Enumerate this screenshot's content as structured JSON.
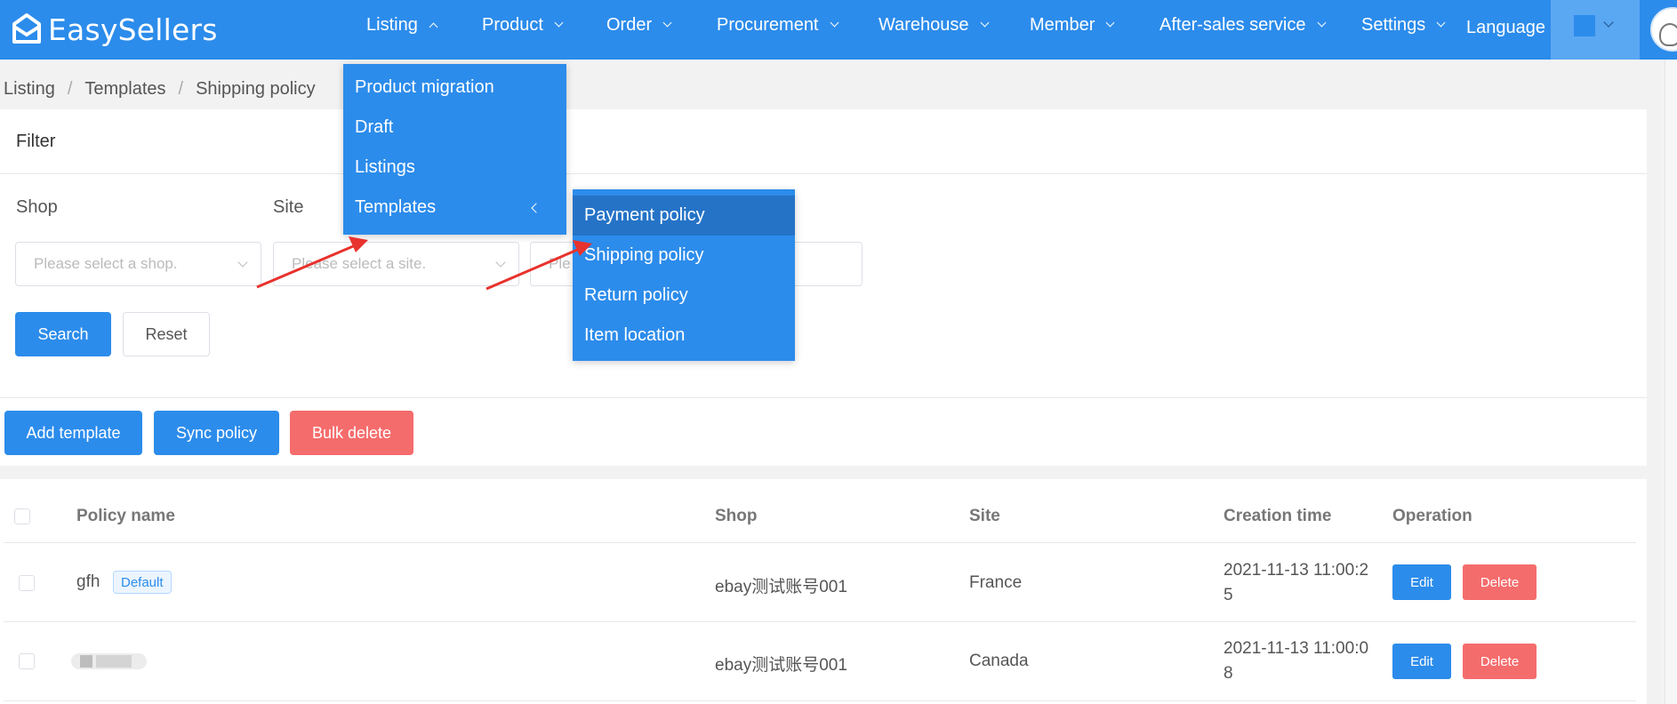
{
  "app": {
    "name": "EasySellers"
  },
  "nav": {
    "items": [
      {
        "label": "Listing"
      },
      {
        "label": "Product"
      },
      {
        "label": "Order"
      },
      {
        "label": "Procurement"
      },
      {
        "label": "Warehouse"
      },
      {
        "label": "Member"
      },
      {
        "label": "After-sales service"
      },
      {
        "label": "Settings"
      }
    ],
    "language": "Language"
  },
  "breadcrumb": [
    "Listing",
    "Templates",
    "Shipping policy"
  ],
  "filter": {
    "title": "Filter",
    "shop_label": "Shop",
    "site_label": "Site",
    "shop_placeholder": "Please select a shop.",
    "site_placeholder": "Please select a site.",
    "third_placeholder": "Ple",
    "search": "Search",
    "reset": "Reset"
  },
  "actions": {
    "add": "Add template",
    "sync": "Sync policy",
    "bulk_delete": "Bulk delete"
  },
  "table": {
    "headers": [
      "Policy name",
      "Shop",
      "Site",
      "Creation time",
      "Operation"
    ],
    "rows": [
      {
        "name": "gfh",
        "tag": "Default",
        "shop": "ebay测试账号001",
        "site": "France",
        "time1": "2021-11-13 11:00:2",
        "time2": "5",
        "edit": "Edit",
        "delete": "Delete"
      },
      {
        "name": "",
        "shop": "ebay测试账号001",
        "site": "Canada",
        "time1": "2021-11-13 11:00:0",
        "time2": "8",
        "edit": "Edit",
        "delete": "Delete"
      }
    ]
  },
  "listing_menu": [
    "Product migration",
    "Draft",
    "Listings",
    "Templates"
  ],
  "templates_menu": [
    "Payment policy",
    "Shipping policy",
    "Return policy",
    "Item location"
  ],
  "colors": {
    "primary": "#2c8ceb",
    "danger": "#f56c6c",
    "menu_active": "#2573c7",
    "annotation": "#e8322d"
  }
}
